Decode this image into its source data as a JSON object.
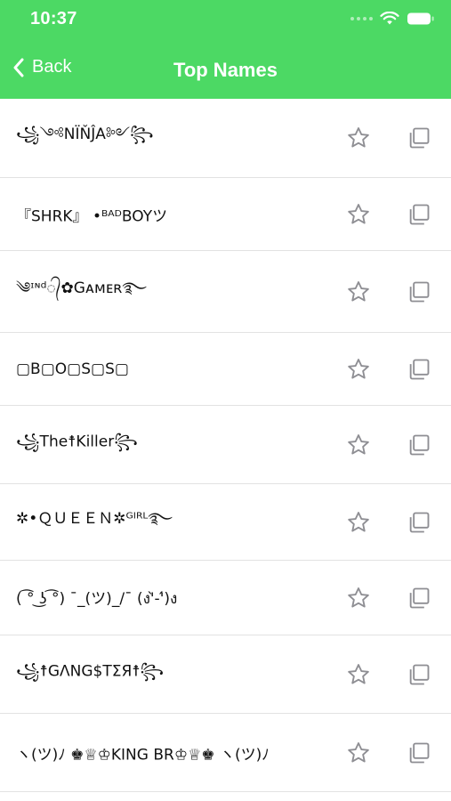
{
  "status_bar": {
    "time": "10:37"
  },
  "nav": {
    "back_label": "Back",
    "title": "Top Names"
  },
  "colors": {
    "header": "#4cd964",
    "icon": "#8e8e93"
  },
  "names": [
    "꧁༺NÏŇĴA༻꧂",
    "『SHRK』 •ᴮᴬᴰBOYツ",
    "༄ᶦᶰᵈ᭄✿Gᴀᴍᴇʀ࿐",
    "▢B▢O▢S▢S▢",
    "꧁The☨Killer꧂",
    "✲•ＱＵＥＥＮ✲ᴳᴵᴿᴸ࿐",
    "( ͡° ͜ʖ ͡°) ¯_(ツ)_/¯ (ง'̀-'́)ง",
    "꧁☨GΛNG$TΣЯ☨꧂",
    "ヽ(ツ)ﾉ ♚♕♔KING BR♔♕♚ ヽ(ツ)ﾉ"
  ],
  "icons": {
    "back": "chevron-left-icon",
    "star": "star-outline-icon",
    "copy": "copy-icon",
    "wifi": "wifi-icon",
    "battery": "battery-icon"
  }
}
